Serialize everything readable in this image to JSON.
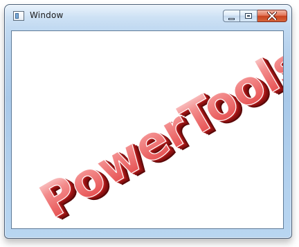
{
  "window": {
    "title": "Window",
    "app_icon": "window-icon",
    "buttons": {
      "minimize_icon": "minimize-icon",
      "maximize_icon": "maximize-icon",
      "close_icon": "close-icon"
    }
  },
  "content": {
    "logo_text": "PowerTools",
    "logo_colors": {
      "face": "#e8423f",
      "face_light": "#f6a0a0",
      "extrusion": "#8b1010",
      "outline": "#ffffff"
    }
  }
}
